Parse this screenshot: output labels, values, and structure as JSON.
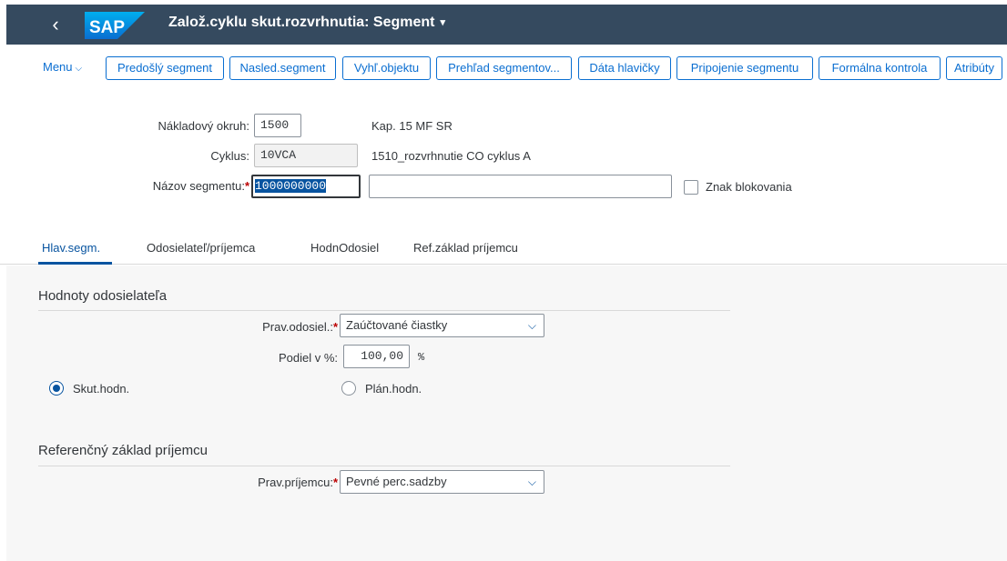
{
  "shell": {
    "back_icon": "‹",
    "logo_text": "SAP",
    "title": "Založ.cyklu skut.rozvrhnutia: Segment",
    "title_caret": "▾"
  },
  "toolbar": {
    "menu_label": "Menu",
    "menu_chevron": "⌵",
    "buttons": [
      "Predošlý segment",
      "Nasled.segment",
      "Vyhľ.objektu",
      "Prehľad segmentov...",
      "Dáta hlavičky",
      "Pripojenie segmentu",
      "Formálna kontrola",
      "Atribúty"
    ]
  },
  "header": {
    "cost_area_label": "Nákladový okruh:",
    "cost_area_value": "1500",
    "cost_area_desc": "Kap. 15 MF SR",
    "cycle_label": "Cyklus:",
    "cycle_value": "10VCA",
    "cycle_desc": "1510_rozvrhnutie CO cyklus A",
    "segment_label": "Názov segmentu:",
    "required_mark": "*",
    "segment_value": "1000000000",
    "segment_text_value": "",
    "lock_label": "Znak blokovania"
  },
  "tabs": [
    "Hlav.segm.",
    "Odosielateľ/príjemca",
    "HodnOdosiel",
    "Ref.základ príjemcu"
  ],
  "sender_section": {
    "title": "Hodnoty odosielateľa",
    "rule_label": "Prav.odosiel.:",
    "rule_value": "Zaúčtované čiastky",
    "share_label": "Podiel v %:",
    "share_value": "100,00",
    "share_unit": "%",
    "radio_actual": "Skut.hodn.",
    "radio_plan": "Plán.hodn."
  },
  "receiver_section": {
    "title": "Referenčný základ príjemcu",
    "rule_label": "Prav.príjemcu:",
    "rule_value": "Pevné perc.sadzby"
  },
  "dropdown_icon": "⌵",
  "colors": {
    "shell_bg": "#354a5f",
    "accent": "#0a6ed1",
    "selected_tab": "#0854a0",
    "required": "#bb0000"
  }
}
